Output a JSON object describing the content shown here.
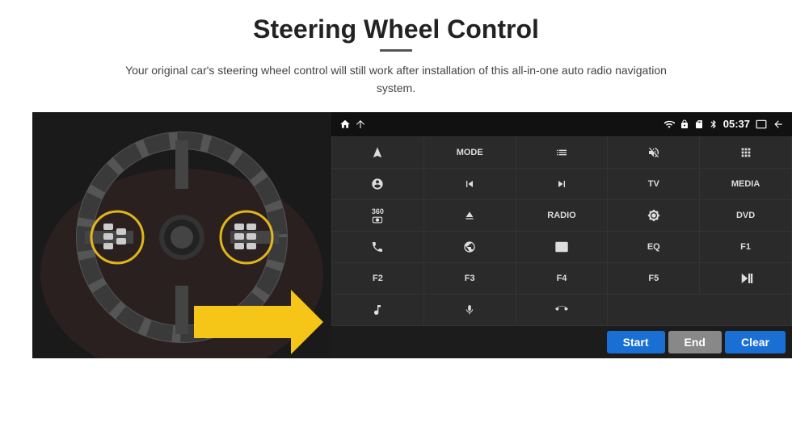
{
  "page": {
    "title": "Steering Wheel Control",
    "subtitle": "Your original car's steering wheel control will still work after installation of this all-in-one auto radio navigation system.",
    "divider": true
  },
  "status_bar": {
    "time": "05:37",
    "icons": [
      "home",
      "wifi",
      "lock",
      "sd",
      "bluetooth",
      "screen",
      "back"
    ]
  },
  "button_grid": [
    {
      "id": "r1c1",
      "label": "",
      "icon": "navigate",
      "span": 1
    },
    {
      "id": "r1c2",
      "label": "MODE",
      "icon": "",
      "span": 1
    },
    {
      "id": "r1c3",
      "label": "",
      "icon": "list",
      "span": 1
    },
    {
      "id": "r1c4",
      "label": "",
      "icon": "mute",
      "span": 1
    },
    {
      "id": "r1c5",
      "label": "",
      "icon": "apps",
      "span": 1
    },
    {
      "id": "r2c1",
      "label": "",
      "icon": "settings-circle",
      "span": 1
    },
    {
      "id": "r2c2",
      "label": "",
      "icon": "prev",
      "span": 1
    },
    {
      "id": "r2c3",
      "label": "",
      "icon": "next",
      "span": 1
    },
    {
      "id": "r2c4",
      "label": "TV",
      "icon": "",
      "span": 1
    },
    {
      "id": "r2c5",
      "label": "MEDIA",
      "icon": "",
      "span": 1
    },
    {
      "id": "r3c1",
      "label": "360",
      "icon": "cam",
      "span": 1
    },
    {
      "id": "r3c2",
      "label": "",
      "icon": "eject",
      "span": 1
    },
    {
      "id": "r3c3",
      "label": "RADIO",
      "icon": "",
      "span": 1
    },
    {
      "id": "r3c4",
      "label": "",
      "icon": "brightness",
      "span": 1
    },
    {
      "id": "r3c5",
      "label": "DVD",
      "icon": "",
      "span": 1
    },
    {
      "id": "r4c1",
      "label": "",
      "icon": "phone",
      "span": 1
    },
    {
      "id": "r4c2",
      "label": "",
      "icon": "globe",
      "span": 1
    },
    {
      "id": "r4c3",
      "label": "",
      "icon": "screen-mirror",
      "span": 1
    },
    {
      "id": "r4c4",
      "label": "EQ",
      "icon": "",
      "span": 1
    },
    {
      "id": "r4c5",
      "label": "F1",
      "icon": "",
      "span": 1
    },
    {
      "id": "r5c1",
      "label": "F2",
      "icon": "",
      "span": 1
    },
    {
      "id": "r5c2",
      "label": "F3",
      "icon": "",
      "span": 1
    },
    {
      "id": "r5c3",
      "label": "F4",
      "icon": "",
      "span": 1
    },
    {
      "id": "r5c4",
      "label": "F5",
      "icon": "",
      "span": 1
    },
    {
      "id": "r5c5",
      "label": "",
      "icon": "play-pause",
      "span": 1
    },
    {
      "id": "r6c1",
      "label": "",
      "icon": "music",
      "span": 1
    },
    {
      "id": "r6c2",
      "label": "",
      "icon": "mic",
      "span": 1
    },
    {
      "id": "r6c3",
      "label": "",
      "icon": "call-end",
      "span": 1
    },
    {
      "id": "r6c4",
      "label": "",
      "icon": "",
      "span": 2
    }
  ],
  "bottom_bar": {
    "start_label": "Start",
    "end_label": "End",
    "clear_label": "Clear"
  }
}
